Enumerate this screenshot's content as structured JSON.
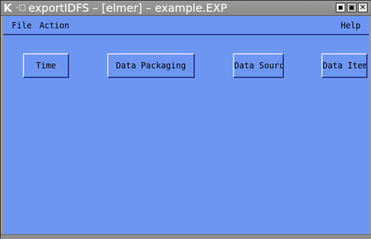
{
  "window": {
    "title": "exportIDFS – [elmer] – example.EXP",
    "app_icon": "K",
    "pin_icon": "-□",
    "controls": {
      "minimize": "▪",
      "maximize": "▣",
      "close": "✕"
    }
  },
  "menubar": {
    "file": "File",
    "action": "Action",
    "help": "Help"
  },
  "main": {
    "buttons": {
      "time": "Time",
      "data_packaging": "Data Packaging",
      "data_source": "Data Source",
      "data_items": "Data Items"
    }
  },
  "colors": {
    "background": "#6d96f2",
    "titlebar": "#8f8f8f",
    "button_highlight": "#c9d8ff",
    "button_shadow": "#2a3f8a"
  }
}
